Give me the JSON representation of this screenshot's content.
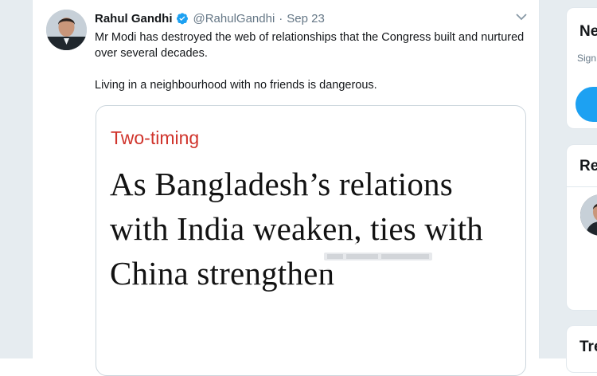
{
  "tweet": {
    "author_name": "Rahul Gandhi",
    "handle": "@RahulGandhi",
    "separator": "·",
    "date": "Sep 23",
    "text_line1": "Mr Modi has destroyed the web of relationships that the Congress built and nurtured over several decades.",
    "text_line2": "Living in a neighbourhood with no friends is dangerous.",
    "icons": {
      "verified": "verified-badge-icon",
      "more": "chevron-down-icon"
    },
    "colors": {
      "verified": "#1da1f2"
    }
  },
  "card": {
    "kicker": "Two-timing",
    "headline": "As Bangladesh’s relations with India weaken, ties with China strengthen",
    "kicker_color": "#d0342c"
  },
  "sidebar": {
    "card1_heading": "Ne",
    "card1_sub": "Sign",
    "card2_heading": "Re",
    "card3_heading": "Tre"
  },
  "colors": {
    "page_background": "#e6ecf0",
    "accent": "#1da1f2",
    "border": "#ccd6dd"
  }
}
